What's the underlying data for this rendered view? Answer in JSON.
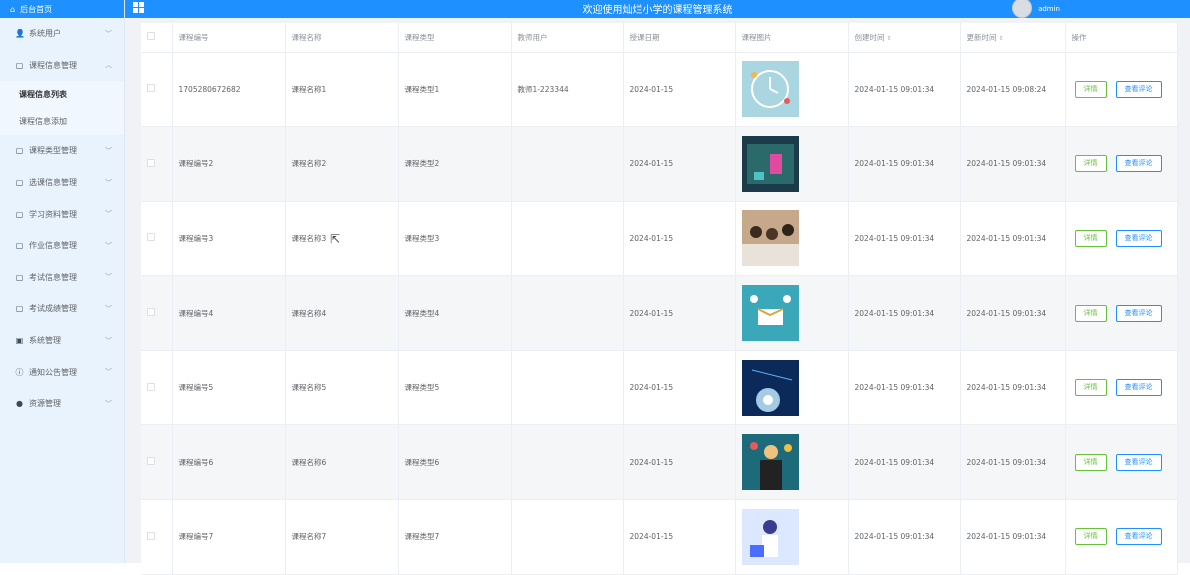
{
  "sidebar": {
    "brand": "后台首页",
    "items": [
      {
        "label": "系统用户",
        "icon": "user-icon",
        "glyph": "👤"
      },
      {
        "label": "课程信息管理",
        "icon": "folder-icon",
        "glyph": "▢",
        "open": true,
        "children": [
          {
            "label": "课程信息列表",
            "active": true
          },
          {
            "label": "课程信息添加"
          }
        ]
      },
      {
        "label": "课程类型管理",
        "icon": "folder-icon",
        "glyph": "▢"
      },
      {
        "label": "选课信息管理",
        "icon": "folder-icon",
        "glyph": "▢"
      },
      {
        "label": "学习资料管理",
        "icon": "folder-icon",
        "glyph": "▢"
      },
      {
        "label": "作业信息管理",
        "icon": "folder-icon",
        "glyph": "▢"
      },
      {
        "label": "考试信息管理",
        "icon": "folder-icon",
        "glyph": "▢"
      },
      {
        "label": "考试成绩管理",
        "icon": "folder-icon",
        "glyph": "▢"
      },
      {
        "label": "系统管理",
        "icon": "system-icon",
        "glyph": "▣"
      },
      {
        "label": "通知公告管理",
        "icon": "info-icon",
        "glyph": "ⓘ"
      },
      {
        "label": "资源管理",
        "icon": "location-icon",
        "glyph": "●"
      }
    ]
  },
  "header": {
    "title": "欢迎使用灿烂小学的课程管理系统",
    "username": "admin"
  },
  "table": {
    "columns": [
      "课程编号",
      "课程名称",
      "课程类型",
      "教师用户",
      "授课日期",
      "课程图片",
      "创建时间",
      "更新时间",
      "操作"
    ],
    "detail_label": "详情",
    "review_label": "查看评论",
    "rows": [
      {
        "code": "1705280672682",
        "name": "课程名称1",
        "type": "课程类型1",
        "teacher": "教师1-223344",
        "date": "2024-01-15",
        "created": "2024-01-15 09:01:34",
        "updated": "2024-01-15 09:08:24",
        "img": "clock"
      },
      {
        "code": "课程编号2",
        "name": "课程名称2",
        "type": "课程类型2",
        "teacher": "",
        "date": "2024-01-15",
        "created": "2024-01-15 09:01:34",
        "updated": "2024-01-15 09:01:34",
        "img": "board"
      },
      {
        "code": "课程编号3",
        "name": "课程名称3",
        "type": "课程类型3",
        "teacher": "",
        "date": "2024-01-15",
        "created": "2024-01-15 09:01:34",
        "updated": "2024-01-15 09:01:34",
        "img": "classroom"
      },
      {
        "code": "课程编号4",
        "name": "课程名称4",
        "type": "课程类型4",
        "teacher": "",
        "date": "2024-01-15",
        "created": "2024-01-15 09:01:34",
        "updated": "2024-01-15 09:01:34",
        "img": "book"
      },
      {
        "code": "课程编号5",
        "name": "课程名称5",
        "type": "课程类型5",
        "teacher": "",
        "date": "2024-01-15",
        "created": "2024-01-15 09:01:34",
        "updated": "2024-01-15 09:01:34",
        "img": "light"
      },
      {
        "code": "课程编号6",
        "name": "课程名称6",
        "type": "课程类型6",
        "teacher": "",
        "date": "2024-01-15",
        "created": "2024-01-15 09:01:34",
        "updated": "2024-01-15 09:01:34",
        "img": "graduate"
      },
      {
        "code": "课程编号7",
        "name": "课程名称7",
        "type": "课程类型7",
        "teacher": "",
        "date": "2024-01-15",
        "created": "2024-01-15 09:01:34",
        "updated": "2024-01-15 09:01:34",
        "img": "studygirl"
      }
    ]
  },
  "colors": {
    "primary": "#1e90ff",
    "success": "#67c23a",
    "sidebar_bg": "#e8f3fd"
  }
}
